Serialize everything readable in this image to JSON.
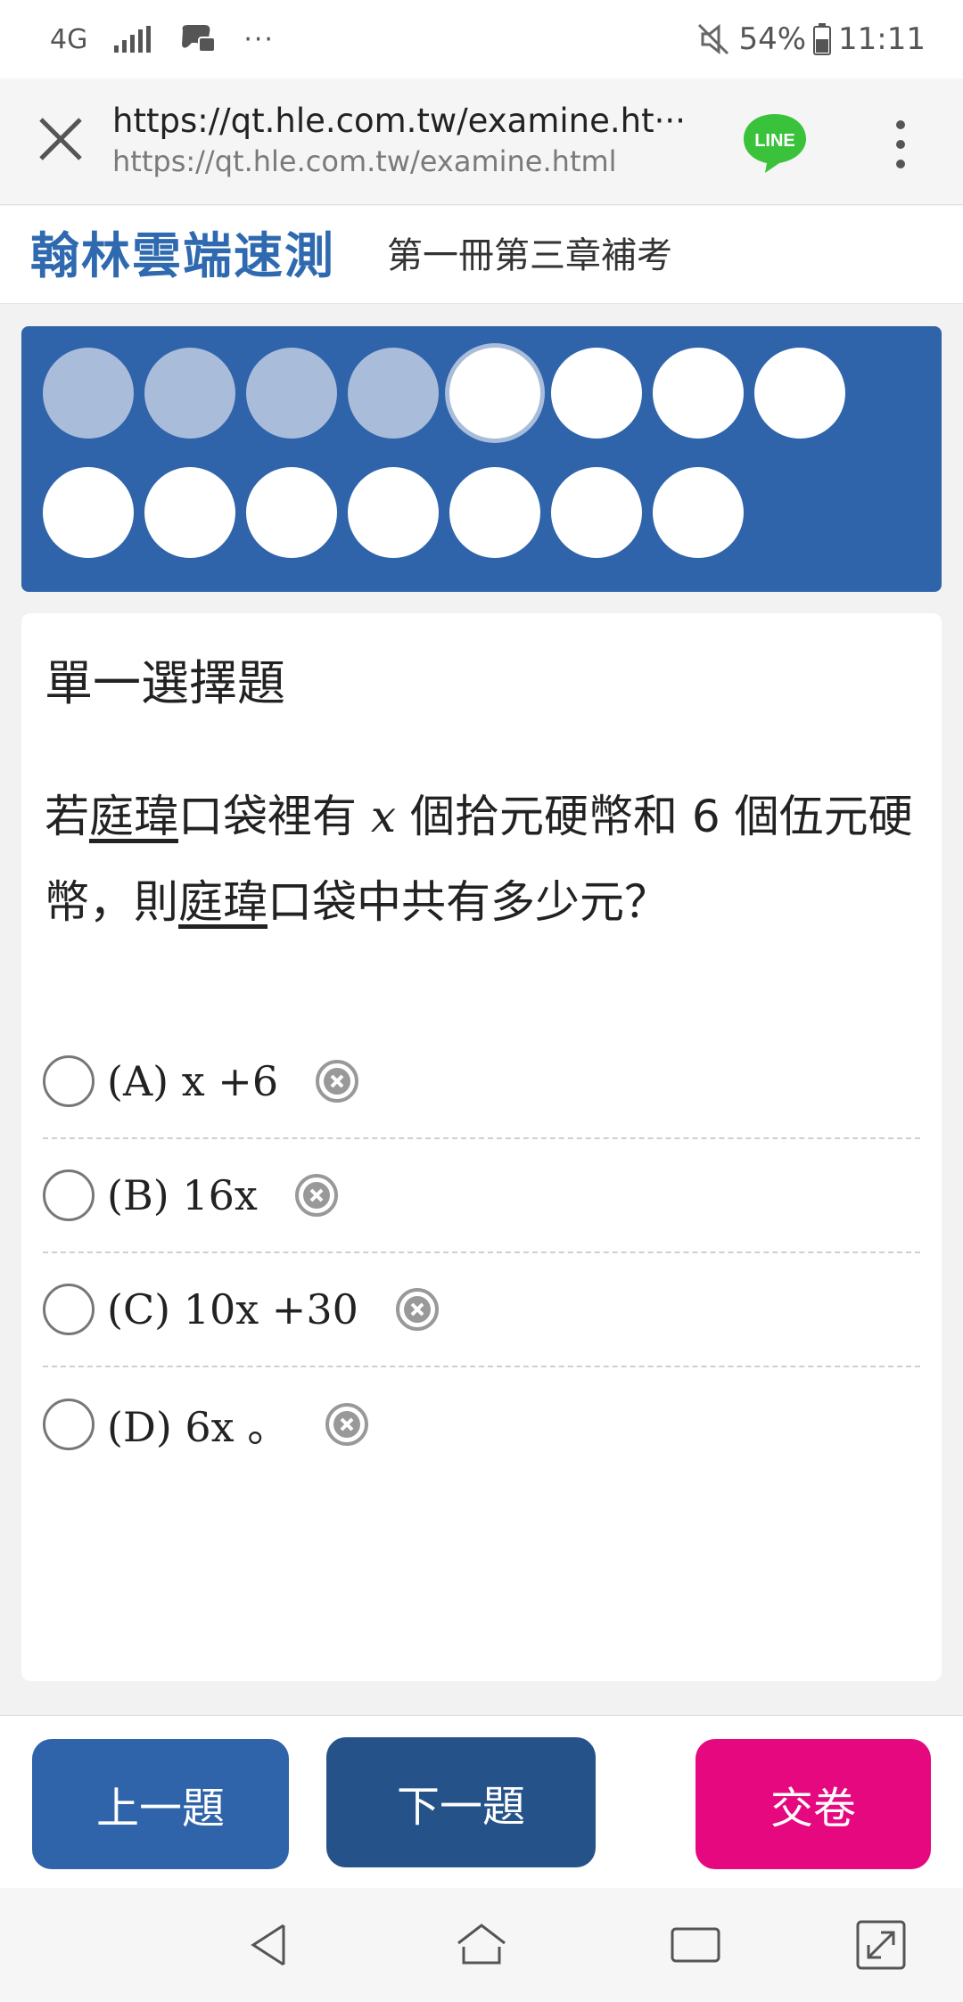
{
  "status_bar": {
    "network": "4G",
    "more": "···",
    "battery": "54%",
    "time": "11:11"
  },
  "url_bar": {
    "title_url": "https://qt.hle.com.tw/examine.ht···",
    "full_url": "https://qt.hle.com.tw/examine.html",
    "line_label": "LINE"
  },
  "header": {
    "brand": "翰林雲端速測",
    "exam_title": "第一冊第三章補考"
  },
  "navigator": {
    "questions": [
      {
        "state": "answered"
      },
      {
        "state": "answered"
      },
      {
        "state": "answered"
      },
      {
        "state": "answered"
      },
      {
        "state": "current"
      },
      {
        "state": "unanswered"
      },
      {
        "state": "unanswered"
      },
      {
        "state": "unanswered"
      },
      {
        "state": "unanswered"
      },
      {
        "state": "unanswered"
      },
      {
        "state": "unanswered"
      },
      {
        "state": "unanswered"
      },
      {
        "state": "unanswered"
      },
      {
        "state": "unanswered"
      },
      {
        "state": "unanswered"
      }
    ]
  },
  "question": {
    "type": "單一選擇題",
    "stem": {
      "p1": "若",
      "name1": "庭瑋",
      "p2": "口袋裡有",
      "var": "x",
      "p3": "個拾元硬幣和 6 個伍元硬幣，則",
      "name2": "庭瑋",
      "p4": "口袋中共有多少元？"
    },
    "options": [
      {
        "label": "(A) x +6"
      },
      {
        "label": "(B) 16x"
      },
      {
        "label": "(C) 10x +30"
      },
      {
        "label": "(D) 6x 。"
      }
    ]
  },
  "actions": {
    "prev": "上一題",
    "next": "下一題",
    "submit": "交卷"
  },
  "colors": {
    "brand_blue": "#2f63aa",
    "answered_dot": "#a9bcda",
    "submit_pink": "#e5087f"
  }
}
